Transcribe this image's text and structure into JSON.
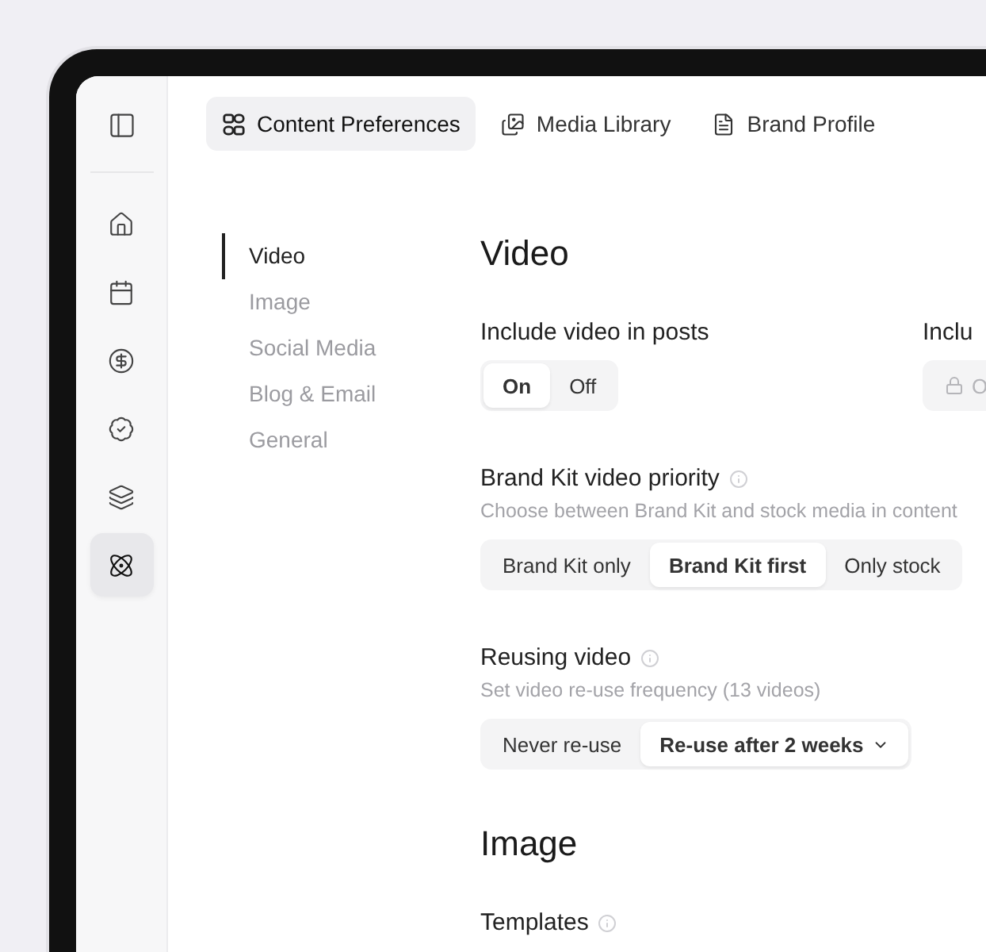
{
  "sidebar": {
    "items": [
      {
        "kind": "home",
        "selected": false
      },
      {
        "kind": "calendar",
        "selected": false
      },
      {
        "kind": "billing",
        "selected": false
      },
      {
        "kind": "approval",
        "selected": false
      },
      {
        "kind": "layers",
        "selected": false
      },
      {
        "kind": "atom",
        "selected": true
      }
    ]
  },
  "tabs": [
    {
      "label": "Content Preferences",
      "kind": "preferences",
      "selected": true
    },
    {
      "label": "Media Library",
      "kind": "media",
      "selected": false
    },
    {
      "label": "Brand Profile",
      "kind": "profile",
      "selected": false
    }
  ],
  "subnav": [
    {
      "label": "Video",
      "selected": true
    },
    {
      "label": "Image",
      "selected": false
    },
    {
      "label": "Social Media",
      "selected": false
    },
    {
      "label": "Blog & Email",
      "selected": false
    },
    {
      "label": "General",
      "selected": false
    }
  ],
  "sections": [
    {
      "title": "Video",
      "settings": [
        {
          "title": "Include video in posts",
          "options": [
            {
              "label": "On",
              "selected": true
            },
            {
              "label": "Off",
              "selected": false
            }
          ],
          "side": {
            "title": "Inclu",
            "locked": true,
            "options": [
              {
                "label": "O",
                "selected": false
              }
            ]
          }
        },
        {
          "title": "Brand Kit video priority",
          "info": true,
          "description": "Choose between Brand Kit and stock media in content",
          "options": [
            {
              "label": "Brand Kit only",
              "selected": false
            },
            {
              "label": "Brand Kit first",
              "selected": true
            },
            {
              "label": "Only stock",
              "selected": false
            }
          ]
        },
        {
          "title": "Reusing video",
          "info": true,
          "description": "Set video re-use frequency (13 videos)",
          "options": [
            {
              "label": "Never re-use",
              "selected": false
            },
            {
              "label": "Re-use after 2 weeks",
              "selected": true,
              "kind": "dropdown"
            }
          ]
        }
      ]
    },
    {
      "title": "Image",
      "settings": [
        {
          "title": "Templates",
          "info": true
        }
      ]
    }
  ]
}
